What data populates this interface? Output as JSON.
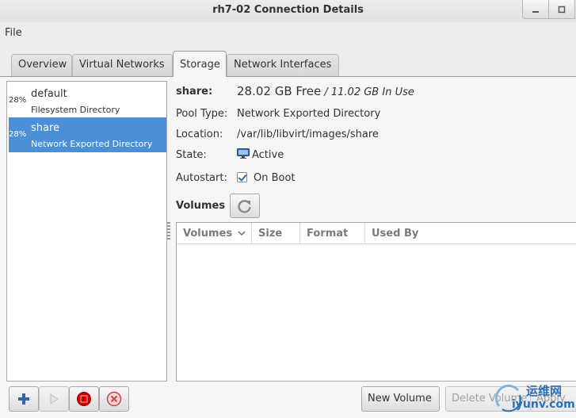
{
  "window": {
    "title": "rh7-02 Connection Details"
  },
  "menu": {
    "file": "File"
  },
  "tabs": [
    {
      "label": "Overview",
      "active": false
    },
    {
      "label": "Virtual Networks",
      "active": false
    },
    {
      "label": "Storage",
      "active": true
    },
    {
      "label": "Network Interfaces",
      "active": false
    }
  ],
  "pools": [
    {
      "usage": "28%",
      "name": "default",
      "type": "Filesystem Directory",
      "selected": false
    },
    {
      "usage": "28%",
      "name": "share",
      "type": "Network Exported Directory",
      "selected": true
    }
  ],
  "details": {
    "name_label": "share:",
    "free": "28.02 GB Free",
    "in_use": "/ 11.02 GB In Use",
    "pool_type_label": "Pool Type:",
    "pool_type": "Network Exported Directory",
    "location_label": "Location:",
    "location": "/var/lib/libvirt/images/share",
    "state_label": "State:",
    "state": "Active",
    "autostart_label": "Autostart:",
    "autostart": "On Boot",
    "autostart_checked": true
  },
  "volumes": {
    "title": "Volumes",
    "columns": [
      "Volumes",
      "Size",
      "Format",
      "Used By"
    ],
    "rows": []
  },
  "buttons": {
    "add_pool_icon": "plus-icon",
    "start_pool_icon": "play-icon",
    "stop_pool_icon": "stop-icon",
    "delete_pool_icon": "delete-icon",
    "new_volume": "New Volume",
    "delete_volume": "Delete Volume",
    "apply": "Apply"
  },
  "watermark": {
    "brand": "运维网",
    "url": "iyunv.com"
  },
  "colors": {
    "selection": "#4a90d9",
    "accent": "#3465a4",
    "stop": "#cc0000"
  }
}
